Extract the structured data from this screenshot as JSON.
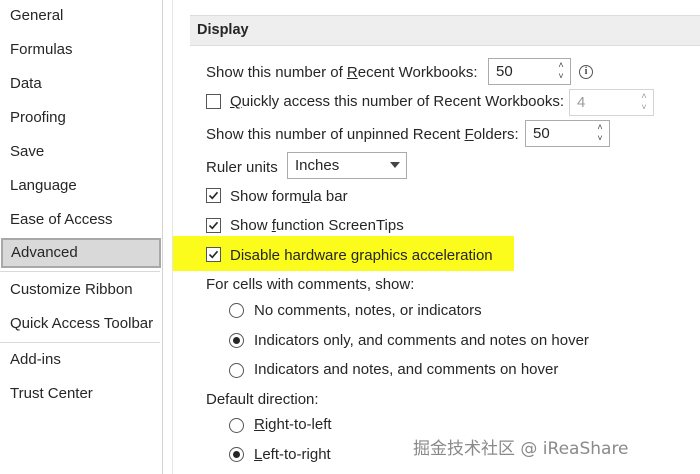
{
  "sidebar": {
    "items": [
      {
        "label": "General"
      },
      {
        "label": "Formulas"
      },
      {
        "label": "Data"
      },
      {
        "label": "Proofing"
      },
      {
        "label": "Save"
      },
      {
        "label": "Language"
      },
      {
        "label": "Ease of Access"
      },
      {
        "label": "Advanced",
        "selected": true
      },
      {
        "label": "Customize Ribbon"
      },
      {
        "label": "Quick Access Toolbar"
      },
      {
        "label": "Add-ins"
      },
      {
        "label": "Trust Center"
      }
    ]
  },
  "display": {
    "title": "Display",
    "recent_workbooks": {
      "pre": "Show this number of ",
      "u": "R",
      "post": "ecent Workbooks:",
      "value": "50"
    },
    "quick_access": {
      "checked": false,
      "u": "Q",
      "post": "uickly access this number of Recent Workbooks:",
      "value": "4"
    },
    "recent_folders": {
      "pre": "Show this number of unpinned Recent ",
      "u": "F",
      "post": "olders:",
      "value": "50"
    },
    "ruler": {
      "pre": "Ruler units",
      "value": "Inches"
    },
    "formula_bar": {
      "checked": true,
      "pre": "Show form",
      "u": "u",
      "post": "la bar"
    },
    "screentips": {
      "checked": true,
      "pre": "Show ",
      "u": "f",
      "post": "unction ScreenTips"
    },
    "hardware": {
      "checked": true,
      "pre": "Disable hardware ",
      "u": "g",
      "post": "raphics acceleration"
    },
    "comments_label": "For cells with comments, show:",
    "comments_options": [
      {
        "label": "No comments, notes, or indicators",
        "selected": false
      },
      {
        "label": "Indicators only, and comments and notes on hover",
        "selected": true
      },
      {
        "label": "Indicators and notes, and comments on hover",
        "selected": false
      }
    ],
    "direction_label": "Default direction:",
    "direction_options": [
      {
        "label": "Right-to-left",
        "selected": false
      },
      {
        "label": "Left-to-right",
        "selected": true
      }
    ]
  },
  "watermark": "掘金技术社区 @ iReaShare",
  "colors": {
    "highlight": "#fbfb1c",
    "selected_nav": "#d9d9d9"
  }
}
